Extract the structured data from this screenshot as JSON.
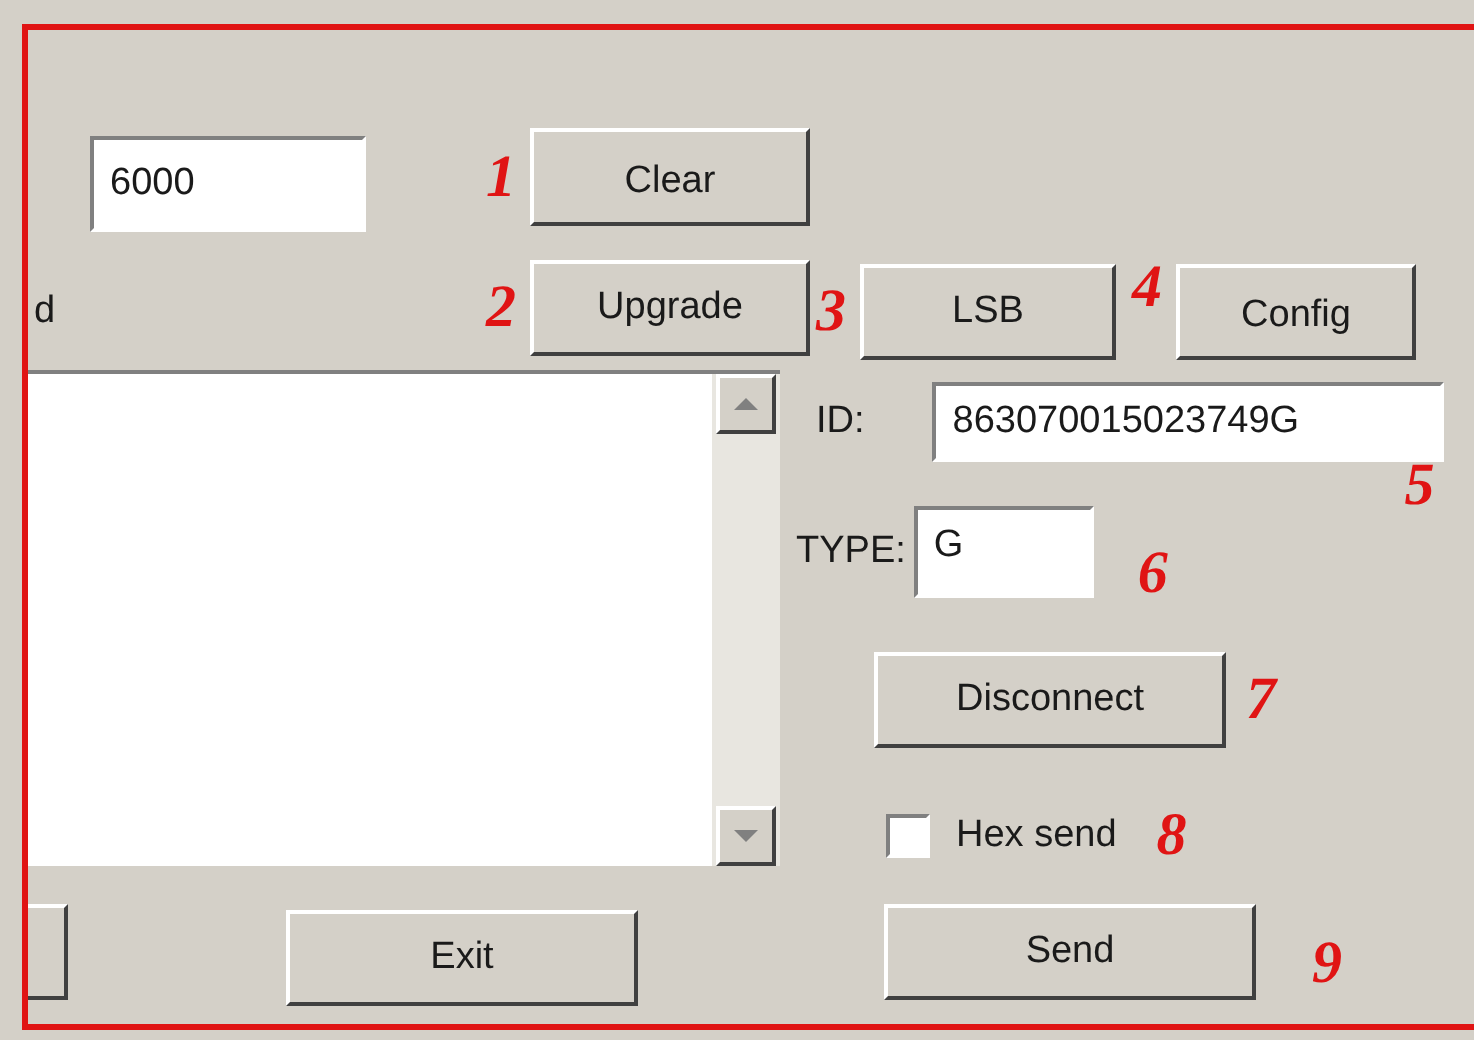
{
  "port_field": {
    "value": "6000"
  },
  "cut_label": "d",
  "clear_button": {
    "label": "Clear",
    "marker": "1"
  },
  "upgrade_button": {
    "label": "Upgrade",
    "marker": "2"
  },
  "lsb_button": {
    "label": "LSB",
    "marker": "3"
  },
  "config_button": {
    "label": "Config",
    "marker": "4"
  },
  "id_field": {
    "label": "ID:",
    "value": "863070015023749G",
    "marker": "5"
  },
  "type_field": {
    "label": "TYPE:",
    "value": "G",
    "marker": "6"
  },
  "disconnect_button": {
    "label": "Disconnect",
    "marker": "7"
  },
  "hex_send": {
    "label": "Hex send",
    "checked": false,
    "marker": "8"
  },
  "exit_button": {
    "label": "Exit"
  },
  "send_button": {
    "label": "Send",
    "marker": "9"
  }
}
